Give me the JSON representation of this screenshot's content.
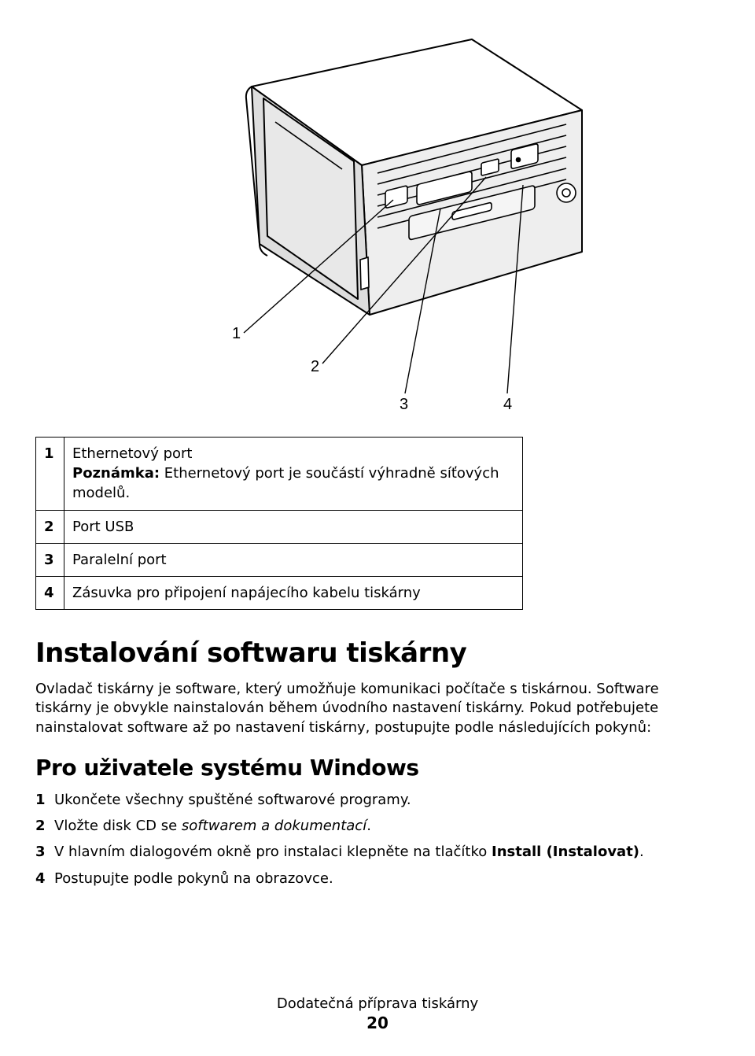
{
  "diagram": {
    "callouts": [
      "1",
      "2",
      "3",
      "4"
    ]
  },
  "port_table": [
    {
      "num": "1",
      "desc": "Ethernetový port",
      "note_label": "Poznámka:",
      "note_text": " Ethernetový port je součástí výhradně síťových modelů."
    },
    {
      "num": "2",
      "desc": "Port USB"
    },
    {
      "num": "3",
      "desc": "Paralelní port"
    },
    {
      "num": "4",
      "desc": "Zásuvka pro připojení napájecího kabelu tiskárny"
    }
  ],
  "section1": {
    "heading": "Instalování softwaru tiskárny",
    "paragraph": "Ovladač tiskárny je software, který umožňuje komunikaci počítače s tiskárnou. Software tiskárny je obvykle nainstalován během úvodního nastavení tiskárny. Pokud potřebujete nainstalovat software až po nastavení tiskárny, postupujte podle následujících pokynů:"
  },
  "section2": {
    "heading": "Pro uživatele systému Windows",
    "steps": [
      {
        "n": "1",
        "pre": "Ukončete všechny spuštěné softwarové programy."
      },
      {
        "n": "2",
        "pre": "Vložte disk CD se ",
        "ital": "softwarem a dokumentací",
        "post": "."
      },
      {
        "n": "3",
        "pre": "V hlavním dialogovém okně pro instalaci klepněte na tlačítko ",
        "bold": "Install (Instalovat)",
        "post": "."
      },
      {
        "n": "4",
        "pre": "Postupujte podle pokynů na obrazovce."
      }
    ]
  },
  "footer": {
    "title": "Dodatečná příprava tiskárny",
    "page": "20"
  }
}
